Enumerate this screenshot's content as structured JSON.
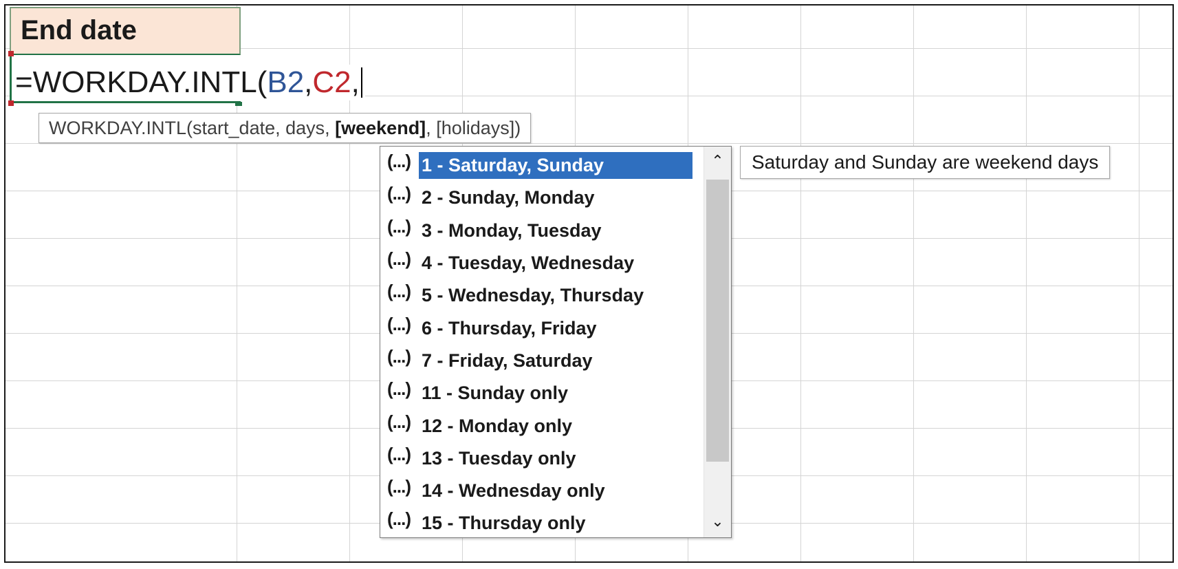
{
  "sheet": {
    "header_cell_text": "End date"
  },
  "formula": {
    "prefix": "=WORKDAY.INTL(",
    "arg1_ref": "B2",
    "sep1": ",",
    "arg2_ref": "C2",
    "sep2": ","
  },
  "signature_tip": {
    "func_and_args": "WORKDAY.INTL(start_date, days, ",
    "current_arg": "[weekend]",
    "rest": ", [holidays])"
  },
  "dropdown": {
    "icon_glyph": "(...)",
    "items": [
      {
        "label": "1 - Saturday, Sunday",
        "selected": true
      },
      {
        "label": "2 - Sunday, Monday"
      },
      {
        "label": "3 - Monday, Tuesday"
      },
      {
        "label": "4 - Tuesday, Wednesday"
      },
      {
        "label": "5 - Wednesday, Thursday"
      },
      {
        "label": "6 - Thursday, Friday"
      },
      {
        "label": "7 - Friday, Saturday"
      },
      {
        "label": "11 - Sunday only"
      },
      {
        "label": "12 - Monday only"
      },
      {
        "label": "13 - Tuesday only"
      },
      {
        "label": "14 - Wednesday only"
      },
      {
        "label": "15 - Thursday only"
      }
    ],
    "scroll_up_icon": "chevron-up-icon",
    "scroll_down_icon": "chevron-down-icon"
  },
  "description_tip": {
    "text": "Saturday and Sunday are weekend days"
  },
  "colors": {
    "selection": "#2f6fbf",
    "ref_b": "#2f5597",
    "ref_c": "#c0282d",
    "header_fill": "#fbe5d6",
    "active_border": "#217346"
  }
}
